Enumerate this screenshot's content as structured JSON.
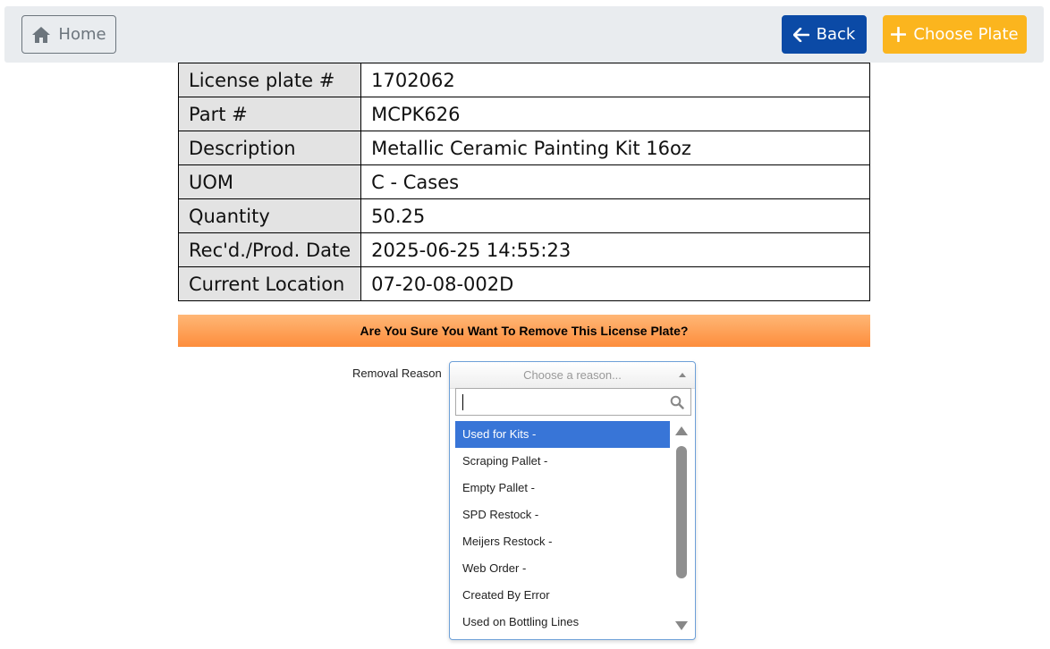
{
  "header": {
    "home_label": "Home",
    "back_label": "Back",
    "choose_plate_label": "Choose Plate"
  },
  "details": [
    {
      "key": "License plate #",
      "value": "1702062"
    },
    {
      "key": "Part #",
      "value": "MCPK626"
    },
    {
      "key": "Description",
      "value": "Metallic Ceramic Painting Kit 16oz"
    },
    {
      "key": "UOM",
      "value": "C - Cases"
    },
    {
      "key": "Quantity",
      "value": "50.25"
    },
    {
      "key": "Rec'd./Prod. Date",
      "value": "2025-06-25 14:55:23"
    },
    {
      "key": "Current Location",
      "value": "07-20-08-002D"
    }
  ],
  "confirm": {
    "message": "Are You Sure You Want To Remove This License Plate?"
  },
  "removal": {
    "label": "Removal Reason",
    "placeholder": "Choose a reason...",
    "search_value": "",
    "options": [
      "Used for Kits -",
      "Scraping Pallet -",
      "Empty Pallet -",
      "SPD Restock -",
      "Meijers Restock -",
      "Web Order -",
      "Created By Error",
      "Used on Bottling Lines"
    ],
    "highlighted_index": 0
  },
  "colors": {
    "back_button": "#0b4aa6",
    "choose_button": "#fbb51e",
    "highlight": "#3875d7",
    "confirm_bar_top": "#ffb776",
    "confirm_bar_bottom": "#fd8d3c"
  }
}
